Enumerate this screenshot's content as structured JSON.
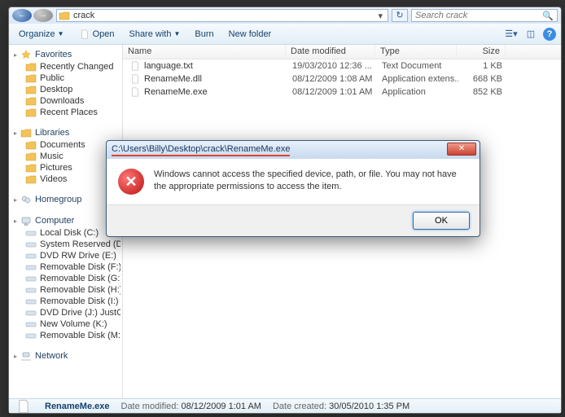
{
  "address": {
    "folder_name": "crack"
  },
  "search": {
    "placeholder": "Search crack"
  },
  "toolbar": {
    "organize": "Organize",
    "open": "Open",
    "share": "Share with",
    "burn": "Burn",
    "newfolder": "New folder"
  },
  "sidebar": {
    "favorites": {
      "label": "Favorites",
      "items": [
        "Recently Changed",
        "Public",
        "Desktop",
        "Downloads",
        "Recent Places"
      ]
    },
    "libraries": {
      "label": "Libraries",
      "items": [
        "Documents",
        "Music",
        "Pictures",
        "Videos"
      ]
    },
    "homegroup": {
      "label": "Homegroup"
    },
    "computer": {
      "label": "Computer",
      "items": [
        "Local Disk (C:)",
        "System Reserved (D:)",
        "DVD RW Drive (E:)",
        "Removable Disk (F:)",
        "Removable Disk (G:)",
        "Removable Disk (H:)",
        "Removable Disk (I:)",
        "DVD Drive (J:) JustCau",
        "New Volume (K:)",
        "Removable Disk (M:)"
      ]
    },
    "network": {
      "label": "Network"
    }
  },
  "columns": {
    "name": "Name",
    "date": "Date modified",
    "type": "Type",
    "size": "Size"
  },
  "files": [
    {
      "name": "language.txt",
      "date": "19/03/2010 12:36 ...",
      "type": "Text Document",
      "size": "1 KB"
    },
    {
      "name": "RenameMe.dll",
      "date": "08/12/2009 1:08 AM",
      "type": "Application extens...",
      "size": "668 KB"
    },
    {
      "name": "RenameMe.exe",
      "date": "08/12/2009 1:01 AM",
      "type": "Application",
      "size": "852 KB"
    }
  ],
  "status": {
    "filename": "RenameMe.exe",
    "mod_label": "Date modified:",
    "mod_value": "08/12/2009 1:01 AM",
    "created_label": "Date created:",
    "created_value": "30/05/2010 1:35 PM"
  },
  "dialog": {
    "title": "C:\\Users\\Billy\\Desktop\\crack\\RenameMe.exe",
    "message": "Windows cannot access the specified device, path, or file.  You may not have the appropriate permissions to access the item.",
    "ok": "OK"
  }
}
